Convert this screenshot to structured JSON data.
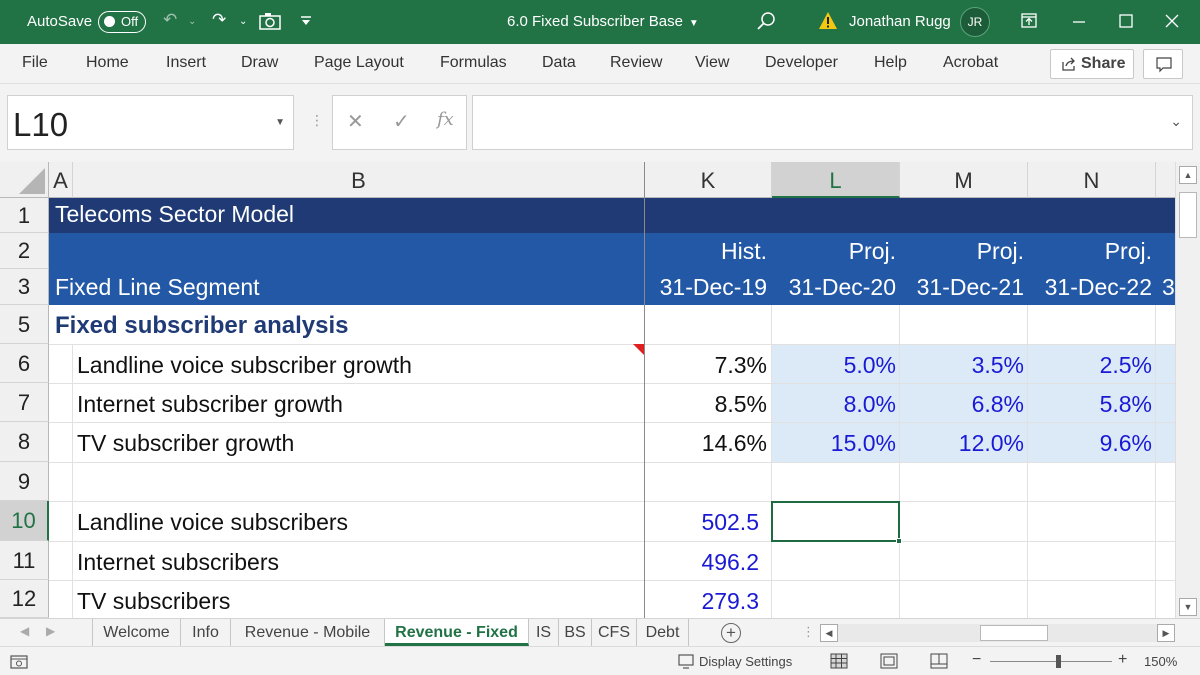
{
  "titlebar": {
    "autosave_label": "AutoSave",
    "autosave_state": "Off",
    "document_title": "6.0 Fixed Subscriber Base",
    "user_name": "Jonathan Rugg",
    "user_initials": "JR",
    "icons": [
      "undo-icon",
      "redo-icon",
      "camera-icon",
      "customize-qat-icon",
      "search-icon",
      "warning-icon",
      "ribbon-display-icon",
      "minimize-icon",
      "maximize-icon",
      "close-icon"
    ]
  },
  "ribbon": {
    "tabs": [
      "File",
      "Home",
      "Insert",
      "Draw",
      "Page Layout",
      "Formulas",
      "Data",
      "Review",
      "View",
      "Developer",
      "Help",
      "Acrobat"
    ],
    "share_label": "Share"
  },
  "formula_bar": {
    "name_box": "L10",
    "fx_label": "fx",
    "cancel_symbol": "✕",
    "enter_symbol": "✓",
    "formula_value": ""
  },
  "grid": {
    "columns": [
      "A",
      "B",
      "K",
      "L",
      "M",
      "N"
    ],
    "rows": [
      "1",
      "2",
      "3",
      "5",
      "6",
      "7",
      "8",
      "9",
      "10",
      "11",
      "12"
    ],
    "title": "Telecoms Sector Model",
    "segment": "Fixed Line Segment",
    "section": "Fixed subscriber analysis",
    "period_types": [
      "Hist.",
      "Proj.",
      "Proj.",
      "Proj."
    ],
    "period_dates": [
      "31-Dec-19",
      "31-Dec-20",
      "31-Dec-21",
      "31-Dec-22",
      "3"
    ],
    "growth_rows": [
      {
        "label": "Landline voice subscriber growth",
        "hist": "7.3%",
        "proj": [
          "5.0%",
          "3.5%",
          "2.5%"
        ]
      },
      {
        "label": "Internet subscriber growth",
        "hist": "8.5%",
        "proj": [
          "8.0%",
          "6.8%",
          "5.8%"
        ]
      },
      {
        "label": "TV subscriber growth",
        "hist": "14.6%",
        "proj": [
          "15.0%",
          "12.0%",
          "9.6%"
        ]
      }
    ],
    "subscriber_rows": [
      {
        "label": "Landline voice subscribers",
        "hist": "502.5"
      },
      {
        "label": "Internet subscribers",
        "hist": "496.2"
      },
      {
        "label": "TV subscribers",
        "hist": "279.3"
      }
    ],
    "selected_cell": "L10"
  },
  "sheet_tabs": {
    "tabs": [
      "Welcome",
      "Info",
      "Revenue - Mobile",
      "Revenue - Fixed",
      "IS",
      "BS",
      "CFS",
      "Debt"
    ],
    "active": "Revenue - Fixed"
  },
  "statusbar": {
    "display_settings": "Display Settings",
    "zoom_minus": "−",
    "zoom_plus": "+",
    "zoom_level": "150%"
  },
  "colors": {
    "excel_green": "#217346",
    "title_band": "#1f3a75",
    "header_band": "#2258a6",
    "input_fill": "#dceaf8",
    "input_font": "#1a1ad4"
  }
}
